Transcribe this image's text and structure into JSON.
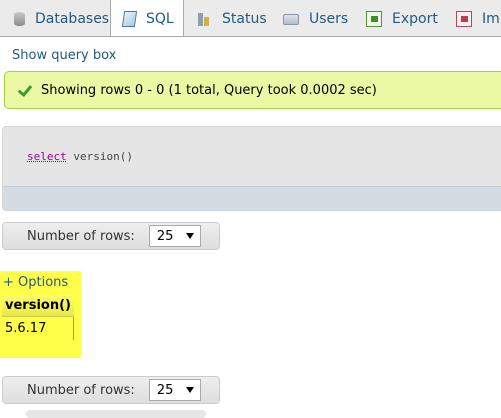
{
  "tabs": [
    {
      "label": "Databases",
      "icon": "database-icon"
    },
    {
      "label": "SQL",
      "icon": "sql-icon",
      "active": true
    },
    {
      "label": "Status",
      "icon": "status-chart-icon"
    },
    {
      "label": "Users",
      "icon": "users-icon"
    },
    {
      "label": "Export",
      "icon": "export-icon"
    },
    {
      "label": "Imp",
      "icon": "import-icon"
    }
  ],
  "show_query_box": "Show query box",
  "success": {
    "icon": "success-check-icon",
    "message": "Showing rows 0 - 0 (1 total, Query took 0.0002 sec)"
  },
  "sql": {
    "keyword": "select",
    "rest": "version()"
  },
  "nav_top": {
    "label": "Number of rows:",
    "value": "25"
  },
  "options_link": "+ Options",
  "result": {
    "columns": [
      "version()"
    ],
    "rows": [
      [
        "5.6.17"
      ]
    ]
  },
  "nav_bottom": {
    "label": "Number of rows:",
    "value": "25"
  },
  "colors": {
    "highlight": "#ffff4a",
    "success_bg": "#ebf8a4",
    "link": "#235a81"
  }
}
